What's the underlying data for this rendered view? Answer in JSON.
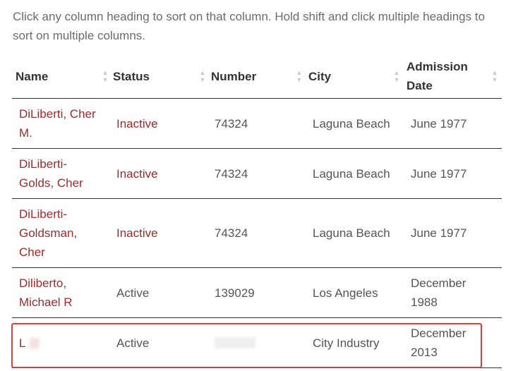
{
  "intro": "Click any column heading to sort on that column. Hold shift and click multiple headings to sort on multiple columns.",
  "columns": {
    "name": "Name",
    "status": "Status",
    "number": "Number",
    "city": "City",
    "admission_line1": "Admission",
    "admission_line2": "Date"
  },
  "sort_icon": "sort-arrows-icon",
  "rows": [
    {
      "name_line1": "DiLiberti, Cher",
      "name_line2": "M.",
      "name_line3": "",
      "status": "Inactive",
      "number": "74324",
      "city": "Laguna Beach",
      "date_line1": "June 1977",
      "date_line2": ""
    },
    {
      "name_line1": "DiLiberti-",
      "name_line2": "Golds, Cher",
      "name_line3": "",
      "status": "Inactive",
      "number": "74324",
      "city": "Laguna Beach",
      "date_line1": "June 1977",
      "date_line2": ""
    },
    {
      "name_line1": "DiLiberti-",
      "name_line2": "Goldsman,",
      "name_line3": "Cher",
      "status": "Inactive",
      "number": "74324",
      "city": "Laguna Beach",
      "date_line1": "June 1977",
      "date_line2": ""
    },
    {
      "name_line1": "Diliberto,",
      "name_line2": "Michael R",
      "name_line3": "",
      "status": "Active",
      "number": "139029",
      "city": "Los Angeles",
      "date_line1": "December",
      "date_line2": "1988"
    },
    {
      "name_line1": "L",
      "name_line2": "",
      "name_line3": "",
      "status": "Active",
      "number": "",
      "city": "City Industry",
      "date_line1": "December",
      "date_line2": "2013"
    }
  ],
  "colors": {
    "link": "#9b2b2b",
    "text": "#555555",
    "highlight": "#e53935"
  }
}
